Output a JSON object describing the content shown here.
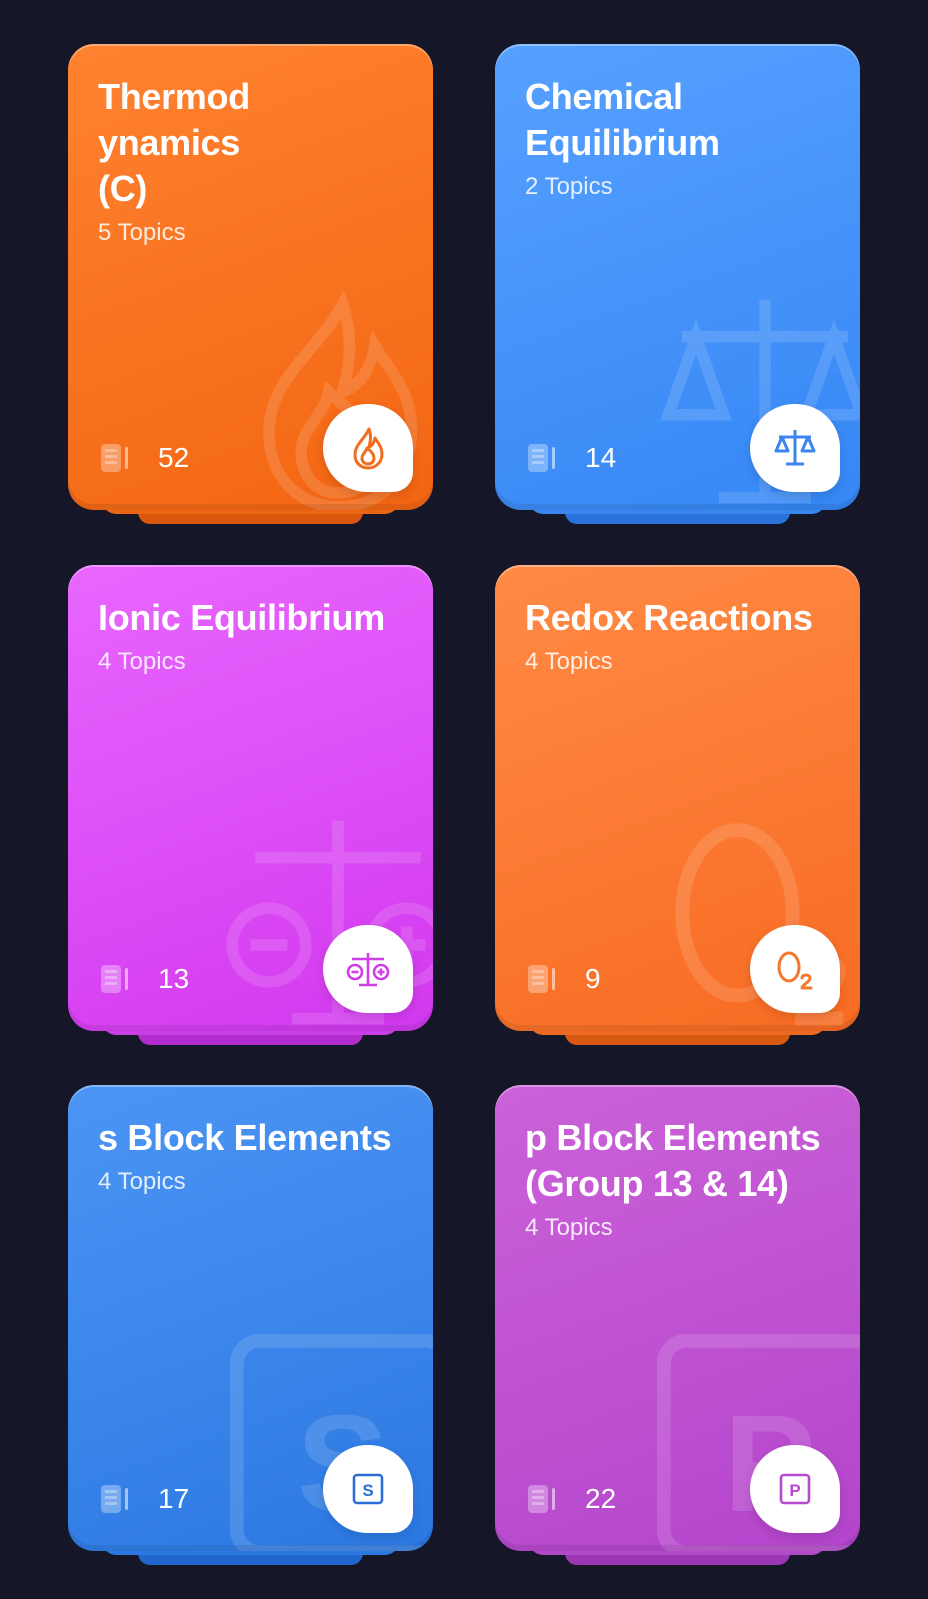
{
  "cards": [
    {
      "title": "Thermod\nynamics\n(C)",
      "topics": "5 Topics",
      "count": "52",
      "icon": "flame-icon",
      "colors": {
        "top": "#ff8230",
        "bottom": "#f26512",
        "stack": "#ec6515",
        "stack2": "#d9570c",
        "icon": "#f26d1c"
      }
    },
    {
      "title": "Chemical\nEquilibrium",
      "topics": "2 Topics",
      "count": "14",
      "icon": "balance-scale-icon",
      "colors": {
        "top": "#57a0ff",
        "bottom": "#3587f5",
        "stack": "#3a86f0",
        "stack2": "#2a73da",
        "icon": "#3a86ee"
      }
    },
    {
      "title": "Ionic Equilibrium",
      "topics": "4 Topics",
      "count": "13",
      "icon": "ion-scale-icon",
      "colors": {
        "top": "#e866ff",
        "bottom": "#d238ee",
        "stack": "#c93fe6",
        "stack2": "#b12dce",
        "icon": "#d03ee8"
      }
    },
    {
      "title": "Redox Reactions",
      "topics": "4 Topics",
      "count": "9",
      "icon": "oxygen-icon",
      "colors": {
        "top": "#ff8a45",
        "bottom": "#f86b22",
        "stack": "#ee6a20",
        "stack2": "#d85a12",
        "icon": "#f4792e"
      }
    },
    {
      "title": "s Block Elements",
      "topics": "4 Topics",
      "count": "17",
      "icon": "s-block-icon",
      "colors": {
        "top": "#4b95f4",
        "bottom": "#2b78e2",
        "stack": "#2d78e0",
        "stack2": "#2166cc",
        "icon": "#2b6fd6"
      }
    },
    {
      "title": "p Block Elements\n(Group 13 & 14)",
      "topics": "4 Topics",
      "count": "22",
      "icon": "p-block-icon",
      "colors": {
        "top": "#cb62d8",
        "bottom": "#b444cc",
        "stack": "#b04ac6",
        "stack2": "#9b36b4",
        "icon": "#b649cc"
      }
    }
  ]
}
